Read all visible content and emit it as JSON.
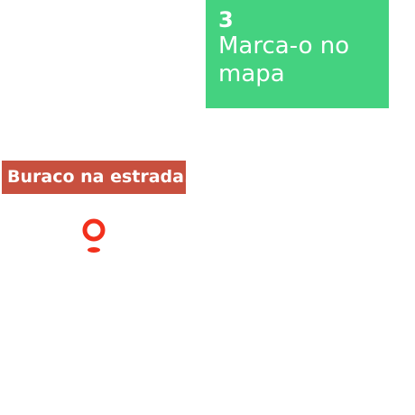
{
  "step_card": {
    "number": "3",
    "text": "Marca-o no mapa",
    "background_color": "#44d280"
  },
  "report_label": {
    "text": "Buraco na estrada.",
    "background_color": "#c8503f"
  },
  "map_pin": {
    "icon": "map-pin-icon",
    "color": "#f2301c"
  }
}
